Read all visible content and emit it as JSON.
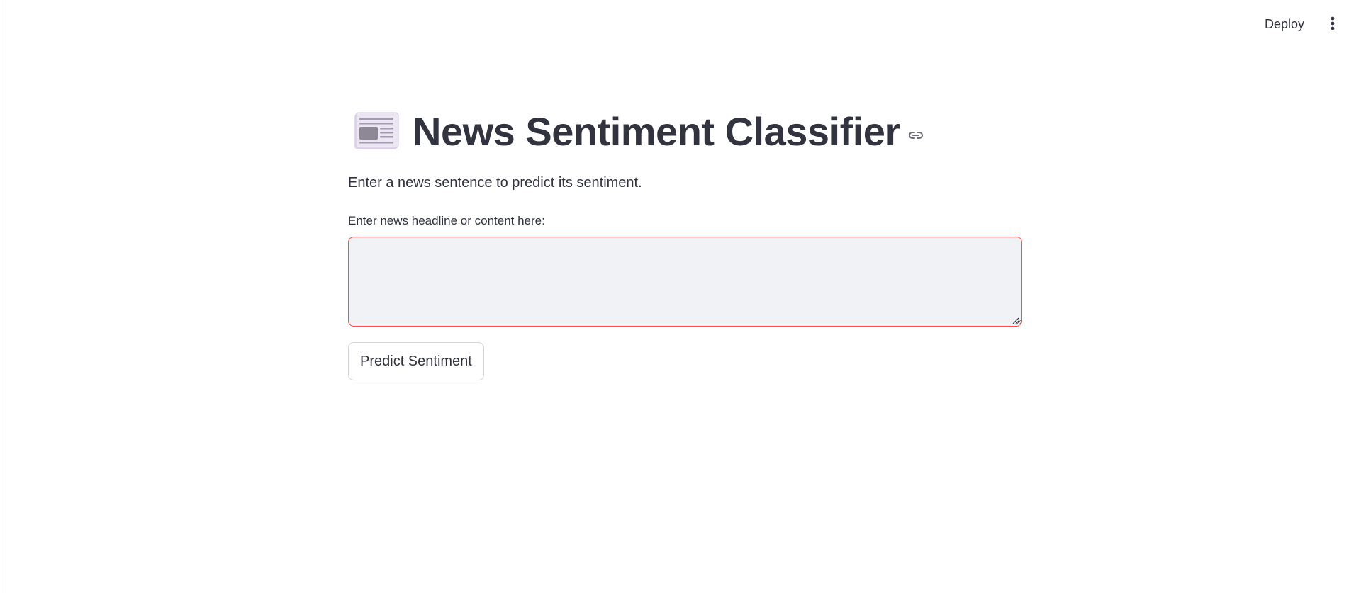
{
  "header": {
    "deploy_label": "Deploy",
    "menu_icon": "more-vertical-icon"
  },
  "main": {
    "title_icon": "newspaper-icon",
    "title": "News Sentiment Classifier",
    "anchor_icon": "link-icon",
    "subtitle": "Enter a news sentence to predict its sentiment.",
    "input": {
      "label": "Enter news headline or content here:",
      "value": "",
      "placeholder": ""
    },
    "predict_button_label": "Predict Sentiment"
  },
  "colors": {
    "text": "#31333f",
    "input_border_focus": "#ff4b4b",
    "input_background": "#f0f2f6",
    "button_border": "#d6d6d9"
  }
}
